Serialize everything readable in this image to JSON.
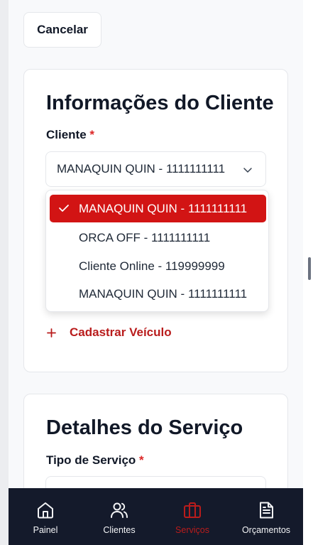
{
  "header": {
    "cancel_label": "Cancelar"
  },
  "client_section": {
    "title": "Informações do Cliente",
    "client_label": "Cliente",
    "required_mark": "*",
    "selected_value": "MANAQUIN QUIN - 1111111111",
    "options": [
      {
        "label": "MANAQUIN QUIN - 1111111111",
        "selected": true
      },
      {
        "label": "ORCA OFF - 1111111111",
        "selected": false
      },
      {
        "label": "Cliente Online - 119999999",
        "selected": false
      },
      {
        "label": "MANAQUIN QUIN - 1111111111",
        "selected": false
      }
    ],
    "add_vehicle_label": "Cadastrar Veículo"
  },
  "service_section": {
    "title": "Detalhes do Serviço",
    "service_type_label": "Tipo de Serviço",
    "required_mark": "*"
  },
  "bottom_nav": {
    "items": [
      {
        "label": "Painel",
        "icon": "home-icon",
        "active": false
      },
      {
        "label": "Clientes",
        "icon": "users-icon",
        "active": false
      },
      {
        "label": "Serviços",
        "icon": "briefcase-icon",
        "active": true
      },
      {
        "label": "Orçamentos",
        "icon": "file-text-icon",
        "active": false
      }
    ]
  },
  "colors": {
    "accent": "#d21414",
    "accent_text": "#b91c1c",
    "nav_background": "#141a2b"
  }
}
